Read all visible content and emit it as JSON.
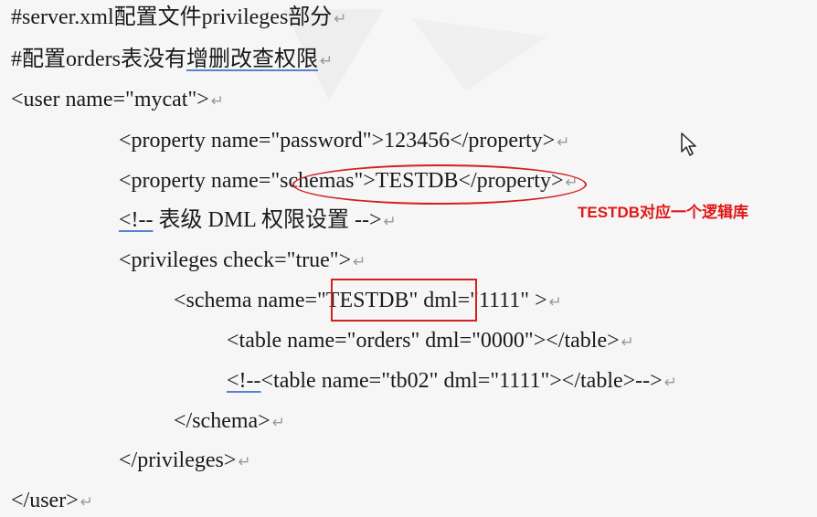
{
  "lines": {
    "l1": "#server.xml配置文件privileges部分",
    "l2a": "#配置orders表没有",
    "l2b": "增删改查权限",
    "l3": "<user name=\"mycat\">",
    "l4": "<property name=\"password\">123456</property>",
    "l5": "<property name=\"schemas\">TESTDB</property>",
    "l6a": "<!--",
    "l6b": " 表级  DML  权限设置  -->",
    "l7": "<privileges check=\"true\">",
    "l8": "<schema name=\"TESTDB\" dml=\"1111\" >",
    "l9": "<table name=\"orders\" dml=\"0000\"></table>",
    "l10a": "<!--",
    "l10b": "<table name=\"tb02\" dml=\"1111\"></table>-->",
    "l11": "</schema>",
    "l12": "</privileges>",
    "l13": "</user>"
  },
  "paragraph_mark": "↵",
  "annotation": "TESTDB对应一个逻辑库",
  "colors": {
    "highlight": "#d42020",
    "annotation_text": "#e01818",
    "spell_underline": "#5b7fd6"
  }
}
